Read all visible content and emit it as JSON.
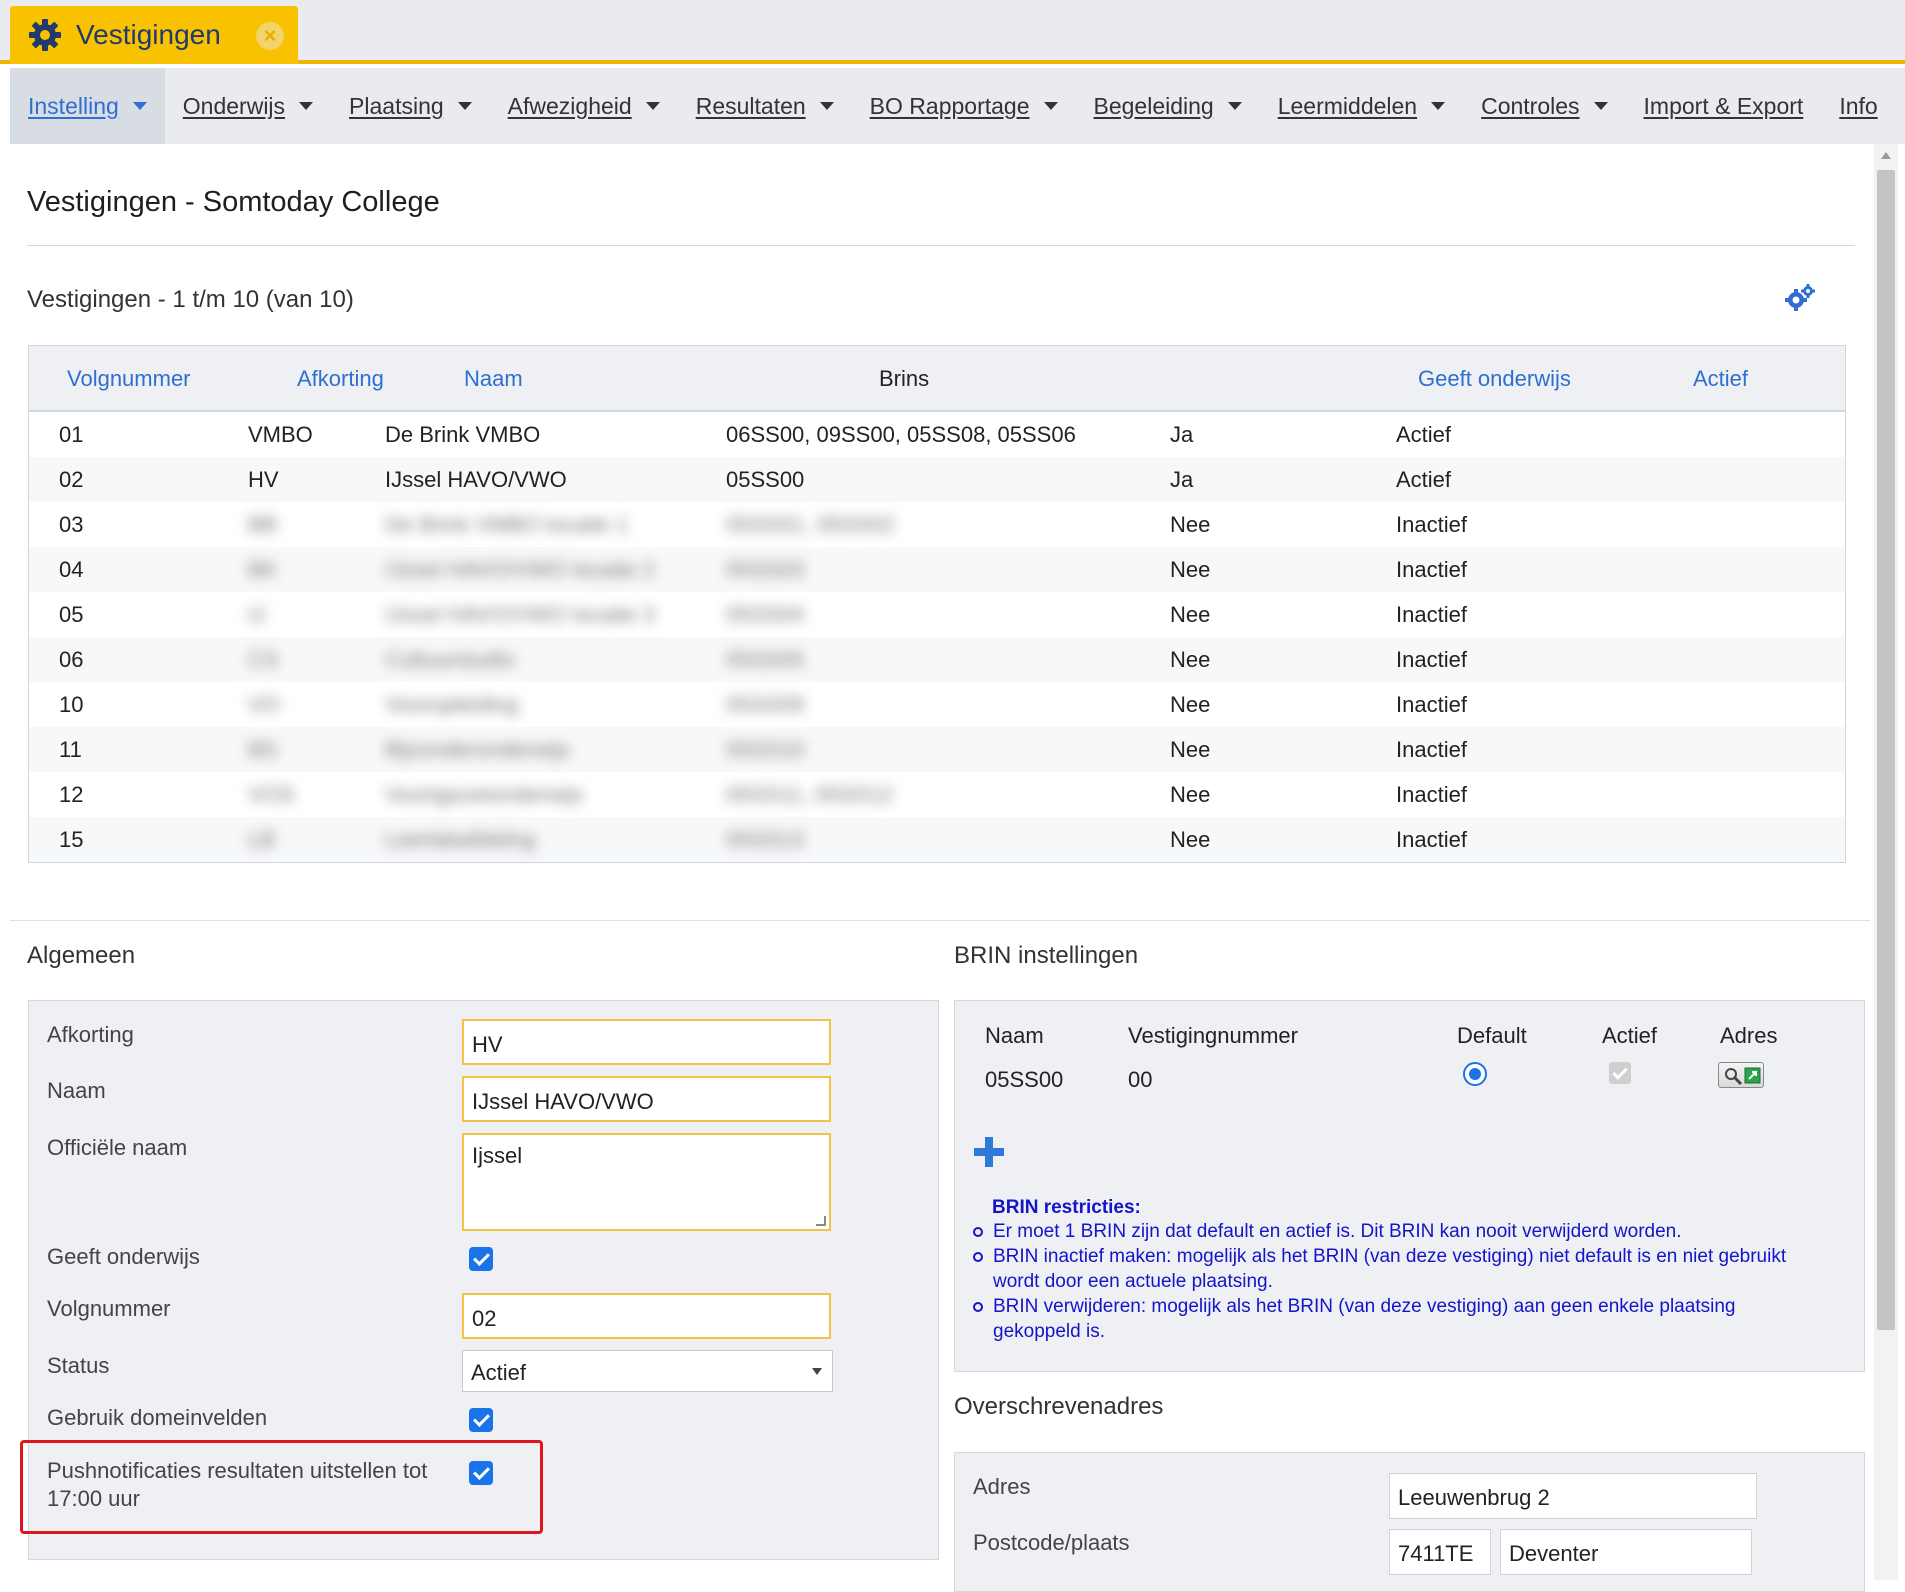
{
  "tab": {
    "title": "Vestigingen",
    "icon": "gear-icon",
    "close_icon": "close-icon"
  },
  "menu": [
    {
      "label": "Instelling",
      "active": true,
      "caret": true
    },
    {
      "label": "Onderwijs",
      "caret": true
    },
    {
      "label": "Plaatsing",
      "caret": true
    },
    {
      "label": "Afwezigheid",
      "caret": true
    },
    {
      "label": "Resultaten",
      "caret": true
    },
    {
      "label": "BO Rapportage",
      "caret": true
    },
    {
      "label": "Begeleiding",
      "caret": true
    },
    {
      "label": "Leermiddelen",
      "caret": true
    },
    {
      "label": "Controles",
      "caret": true
    },
    {
      "label": "Import & Export",
      "caret": false
    },
    {
      "label": "Info",
      "caret": false
    }
  ],
  "page_title": "Vestigingen - Somtoday College",
  "list_title": "Vestigingen - 1 t/m 10 (van 10)",
  "table": {
    "headers": {
      "volgnummer": "Volgnummer",
      "afkorting": "Afkorting",
      "naam": "Naam",
      "brins": "Brins",
      "geeft": "Geeft onderwijs",
      "actief": "Actief"
    },
    "rows": [
      {
        "volgnummer": "01",
        "afkorting": "VMBO",
        "naam": "De Brink VMBO",
        "brins": "06SS00, 09SS00, 05SS08, 05SS06",
        "geeft": "Ja",
        "actief": "Actief",
        "blurred": false
      },
      {
        "volgnummer": "02",
        "afkorting": "HV",
        "naam": "IJssel HAVO/VWO",
        "brins": "05SS00",
        "geeft": "Ja",
        "actief": "Actief",
        "blurred": false
      },
      {
        "volgnummer": "03",
        "afkorting": "BB",
        "naam": "De Brink VMBO locatie 1",
        "brins": "05SS01, 05SS02",
        "geeft": "Nee",
        "actief": "Inactief",
        "blurred": true
      },
      {
        "volgnummer": "04",
        "afkorting": "BK",
        "naam": "IJssel HAVO/VWO locatie 2",
        "brins": "05SS03",
        "geeft": "Nee",
        "actief": "Inactief",
        "blurred": true
      },
      {
        "volgnummer": "05",
        "afkorting": "IJ",
        "naam": "IJssel HAVO/VWO locatie 3",
        "brins": "05SS04",
        "geeft": "Nee",
        "actief": "Inactief",
        "blurred": true
      },
      {
        "volgnummer": "06",
        "afkorting": "CS",
        "naam": "Cultuurstudio",
        "brins": "05SS05",
        "geeft": "Nee",
        "actief": "Inactief",
        "blurred": true
      },
      {
        "volgnummer": "10",
        "afkorting": "VO",
        "naam": "Vooropleiding",
        "brins": "05SS09",
        "geeft": "Nee",
        "actief": "Inactief",
        "blurred": true
      },
      {
        "volgnummer": "11",
        "afkorting": "BS",
        "naam": "Bijzonderonderwijs",
        "brins": "05SS10",
        "geeft": "Nee",
        "actief": "Inactief",
        "blurred": true
      },
      {
        "volgnummer": "12",
        "afkorting": "VOS",
        "naam": "Voortgezetonderwijs",
        "brins": "05SS11, 05SS12",
        "geeft": "Nee",
        "actief": "Inactief",
        "blurred": true
      },
      {
        "volgnummer": "15",
        "afkorting": "LB",
        "naam": "Leerlabafdeling",
        "brins": "05SS13",
        "geeft": "Nee",
        "actief": "Inactief",
        "blurred": true
      }
    ]
  },
  "algemeen": {
    "title": "Algemeen",
    "afkorting_label": "Afkorting",
    "afkorting_value": "HV",
    "naam_label": "Naam",
    "naam_value": "IJssel HAVO/VWO",
    "officiele_label": "Officiële naam",
    "officiele_value": "Ijssel",
    "geeft_label": "Geeft onderwijs",
    "volgnummer_label": "Volgnummer",
    "volgnummer_value": "02",
    "status_label": "Status",
    "status_value": "Actief",
    "domein_label": "Gebruik domeinvelden",
    "push_label_1": "Pushnotificaties resultaten uitstellen tot",
    "push_label_2": "17:00 uur"
  },
  "brin": {
    "title": "BRIN instellingen",
    "headers": {
      "naam": "Naam",
      "vestigingnummer": "Vestigingnummer",
      "default": "Default",
      "actief": "Actief",
      "adres": "Adres"
    },
    "row": {
      "naam": "05SS00",
      "vestigingnummer": "00"
    },
    "restr_title": "BRIN restricties:",
    "restrictions": [
      "Er moet 1 BRIN zijn dat default en actief is. Dit BRIN kan nooit verwijderd worden.",
      "BRIN inactief maken: mogelijk als het BRIN (van deze vestiging) niet default is en niet gebruikt wordt door een actuele plaatsing.",
      "BRIN verwijderen: mogelijk als het BRIN (van deze vestiging) aan geen enkele plaatsing gekoppeld is."
    ]
  },
  "overschreven": {
    "title": "Overschrevenadres",
    "adres_label": "Adres",
    "adres_value": "Leeuwenbrug 2",
    "postcode_label": "Postcode/plaats",
    "postcode_value": "7411TE",
    "plaats_value": "Deventer"
  },
  "colors": {
    "accent": "#2f6fd1",
    "tab": "#f8c200",
    "highlight": "#e0161e",
    "restrictions": "#1414c8"
  }
}
